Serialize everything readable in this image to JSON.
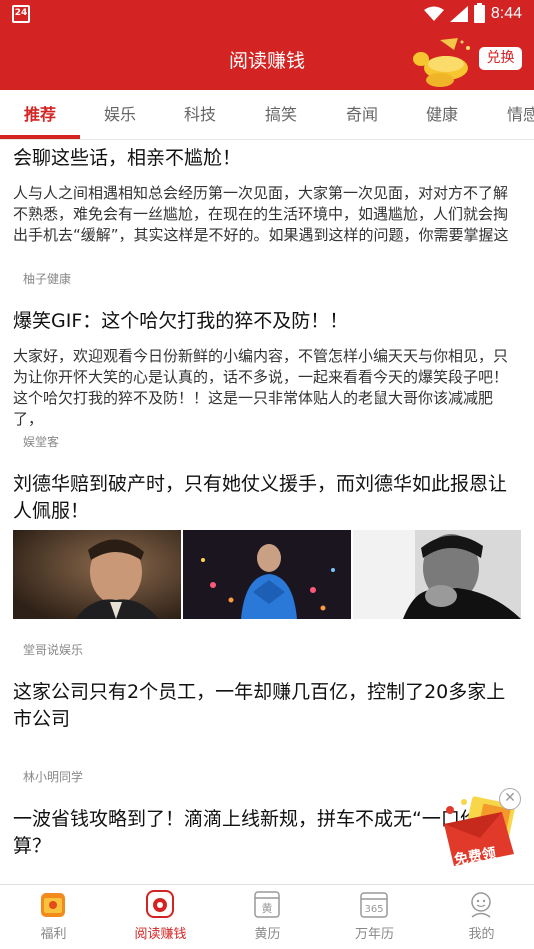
{
  "status_bar": {
    "calendar_day": "24",
    "time": "8:44"
  },
  "header": {
    "title": "阅读赚钱",
    "exchange_label": "兑换"
  },
  "tabs": [
    {
      "label": "推荐",
      "active": true
    },
    {
      "label": "娱乐"
    },
    {
      "label": "科技"
    },
    {
      "label": "搞笑"
    },
    {
      "label": "奇闻"
    },
    {
      "label": "健康"
    },
    {
      "label": "情感"
    }
  ],
  "articles": [
    {
      "title": "会聊这些话，相亲不尴尬！",
      "summary": "人与人之间相遇相知总会经历第一次见面，大家第一次见面，对对方不了解不熟悉，难免会有一丝尴尬，在现在的生活环境中，如遇尴尬，人们就会掏出手机去“缓解”，其实这样是不好的。如果遇到这样的问题，你需要掌握这",
      "source": "柚子健康"
    },
    {
      "title": "爆笑GIF：这个哈欠打我的猝不及防！！",
      "summary": "大家好，欢迎观看今日份新鲜的小编内容，不管怎样小编天天与你相见，只为让你开怀大笑的心是认真的，话不多说，一起来看看今天的爆笑段子吧！这个哈欠打我的猝不及防！！这是一只非常体贴人的老鼠大哥你该减减肥了，",
      "source": "娱堂客"
    },
    {
      "title": "刘德华赔到破产时，只有她仗义援手，而刘德华如此报恩让人佩服！",
      "source": "堂哥说娱乐",
      "thumbnails": [
        "portrait-photo",
        "concert-photo",
        "black-white-photo"
      ]
    },
    {
      "title": "这家公司只有2个员工，一年却赚几百亿，控制了20多家上市公司",
      "source": "林小明同学"
    },
    {
      "title": "一波省钱攻略到了！滴滴上线新规，拼车不成无“一口价”划算？"
    }
  ],
  "floating_gift": {
    "label": "免费领"
  },
  "bottom_nav": [
    {
      "label": "福利",
      "icon": "gift-icon"
    },
    {
      "label": "阅读赚钱",
      "icon": "read-earn-icon",
      "active": true
    },
    {
      "label": "黄历",
      "icon": "almanac-icon",
      "glyph": "黄"
    },
    {
      "label": "万年历",
      "icon": "calendar-icon",
      "glyph": "365"
    },
    {
      "label": "我的",
      "icon": "profile-icon"
    }
  ],
  "colors": {
    "brand_red": "#d42323",
    "text": "#222222",
    "muted": "#888888"
  }
}
